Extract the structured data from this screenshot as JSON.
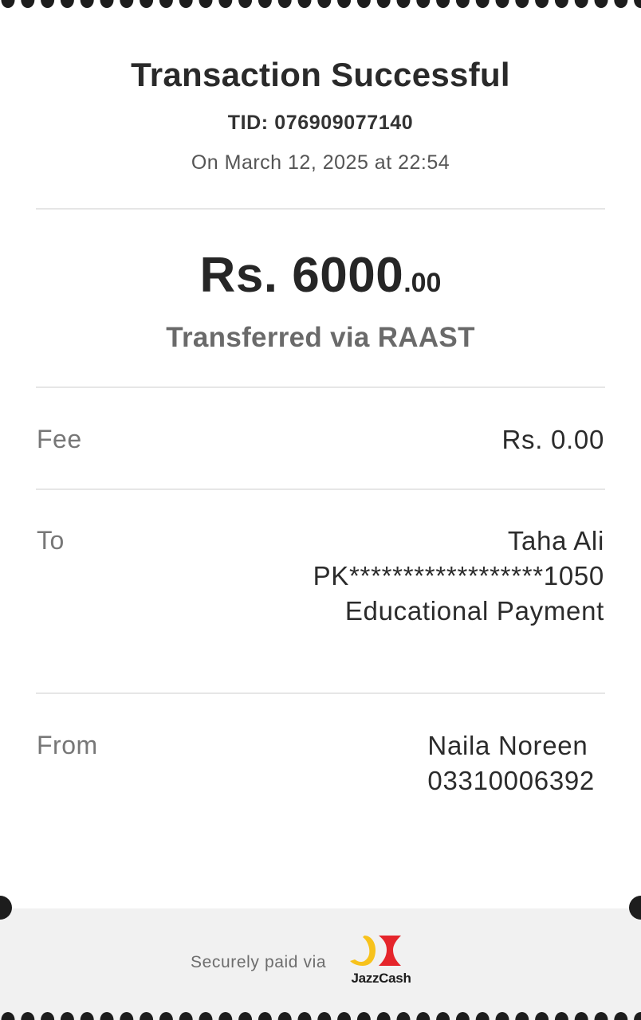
{
  "receipt": {
    "title": "Transaction Successful",
    "tid": "TID: 076909077140",
    "date": "On March 12, 2025 at 22:54",
    "amount_main": "Rs. 6000",
    "amount_decimal": ".00",
    "method": "Transferred via RAAST"
  },
  "fee": {
    "label": "Fee",
    "value": "Rs. 0.00"
  },
  "to": {
    "label": "To",
    "name": "Taha Ali",
    "account": "PK******************1050",
    "purpose": "Educational Payment"
  },
  "from": {
    "label": "From",
    "name": "Naila Noreen",
    "phone": "03310006392"
  },
  "footer": {
    "secure_text": "Securely paid via",
    "brand": "JazzCash",
    "logo_icon": "jazzcash-logo-icon"
  },
  "colors": {
    "brand_yellow": "#F7C21C",
    "brand_red": "#E5252B",
    "perforation": "#1d1d1d"
  }
}
